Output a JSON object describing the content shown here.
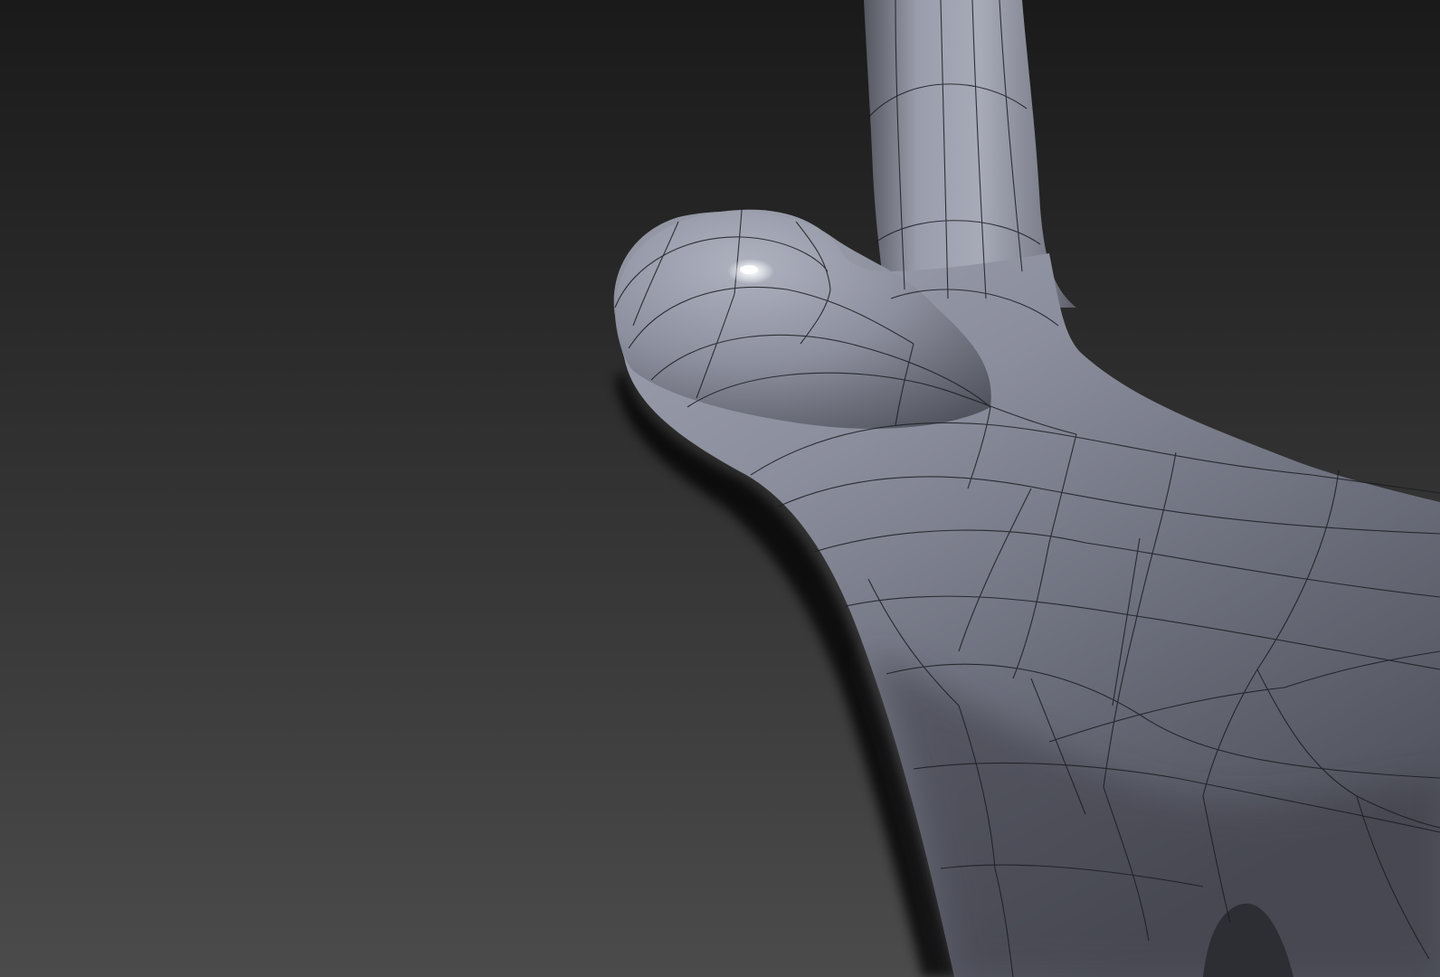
{
  "viewport": {
    "background_top": "#1a1a1a",
    "background_bottom": "#4b4b4b",
    "mesh_light": "#a3a6b3",
    "mesh_mid": "#7d8090",
    "mesh_dark": "#3b3c45",
    "wire_color": "#1b1c22",
    "highlight_color": "#ffffff"
  }
}
